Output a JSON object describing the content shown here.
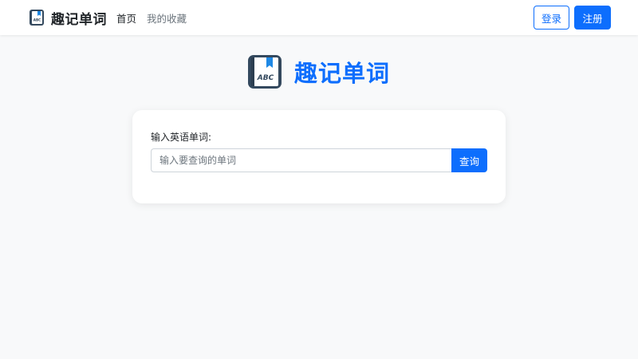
{
  "navbar": {
    "brand": "趣记单词",
    "links": [
      "首页",
      "我的收藏"
    ],
    "login": "登录",
    "register": "注册"
  },
  "hero": {
    "title": "趣记单词",
    "logo_text": "ABC"
  },
  "search": {
    "label": "输入英语单词:",
    "placeholder": "输入要查询的单词",
    "button": "查询"
  },
  "colors": {
    "primary": "#0d6efd",
    "background": "#f8f9fa",
    "text": "#212529",
    "muted": "#6c757d"
  },
  "icons": [
    "book-logo-icon"
  ]
}
